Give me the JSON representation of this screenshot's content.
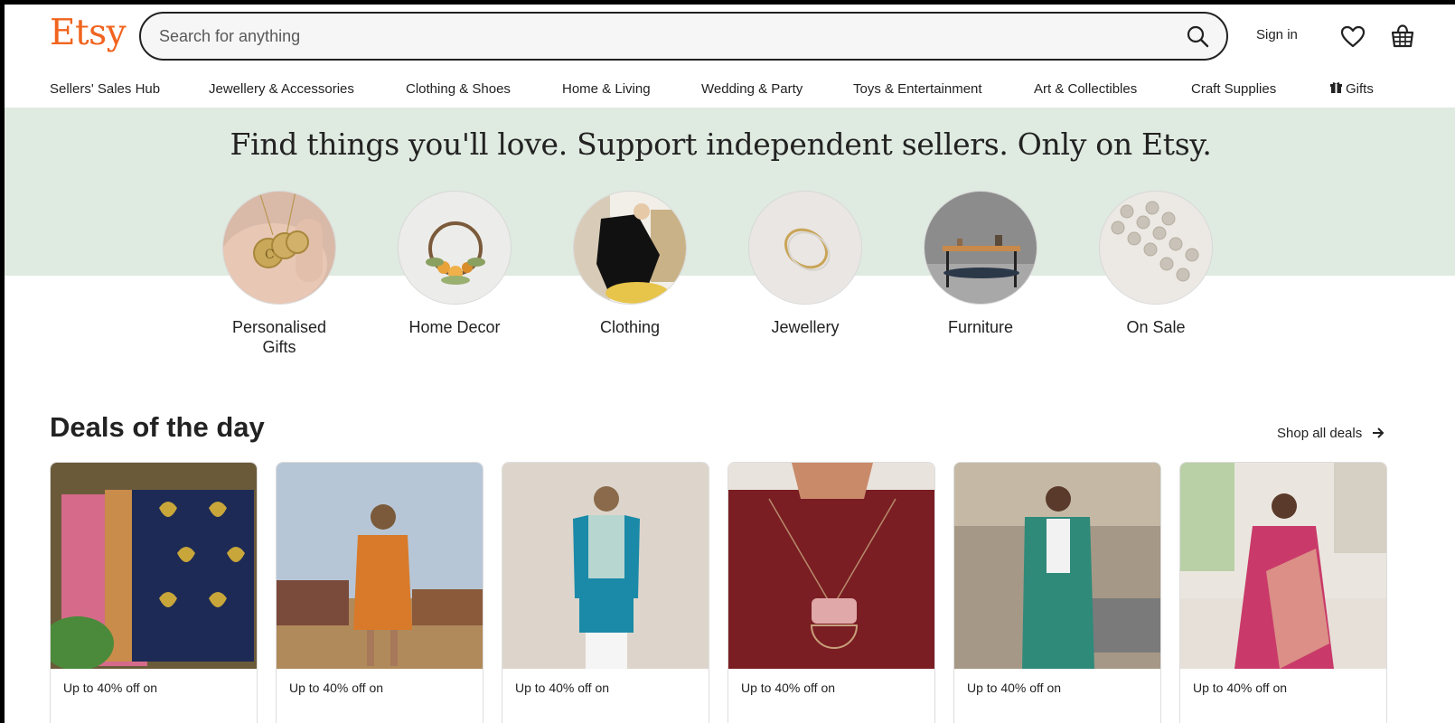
{
  "header": {
    "logo": "Etsy",
    "search_placeholder": "Search for anything",
    "signin": "Sign in"
  },
  "nav": [
    "Sellers' Sales Hub",
    "Jewellery & Accessories",
    "Clothing & Shoes",
    "Home & Living",
    "Wedding & Party",
    "Toys & Entertainment",
    "Art & Collectibles",
    "Craft Supplies",
    "Gifts"
  ],
  "hero": {
    "title": "Find things you'll love. Support independent sellers. Only on Etsy."
  },
  "categories": [
    "Personalised Gifts",
    "Home Decor",
    "Clothing",
    "Jewellery",
    "Furniture",
    "On Sale"
  ],
  "deals": {
    "title": "Deals of the day",
    "shop_all": "Shop all deals",
    "cards": [
      "Up to 40% off on",
      "Up to 40% off on",
      "Up to 40% off on",
      "Up to 40% off on",
      "Up to 40% off on",
      "Up to 40% off on"
    ]
  },
  "colors": {
    "brand": "#f1641e",
    "hero_bg": "#dfeae0"
  },
  "icons": [
    "search-icon",
    "heart-icon",
    "cart-icon",
    "gift-icon",
    "arrow-right-icon"
  ]
}
